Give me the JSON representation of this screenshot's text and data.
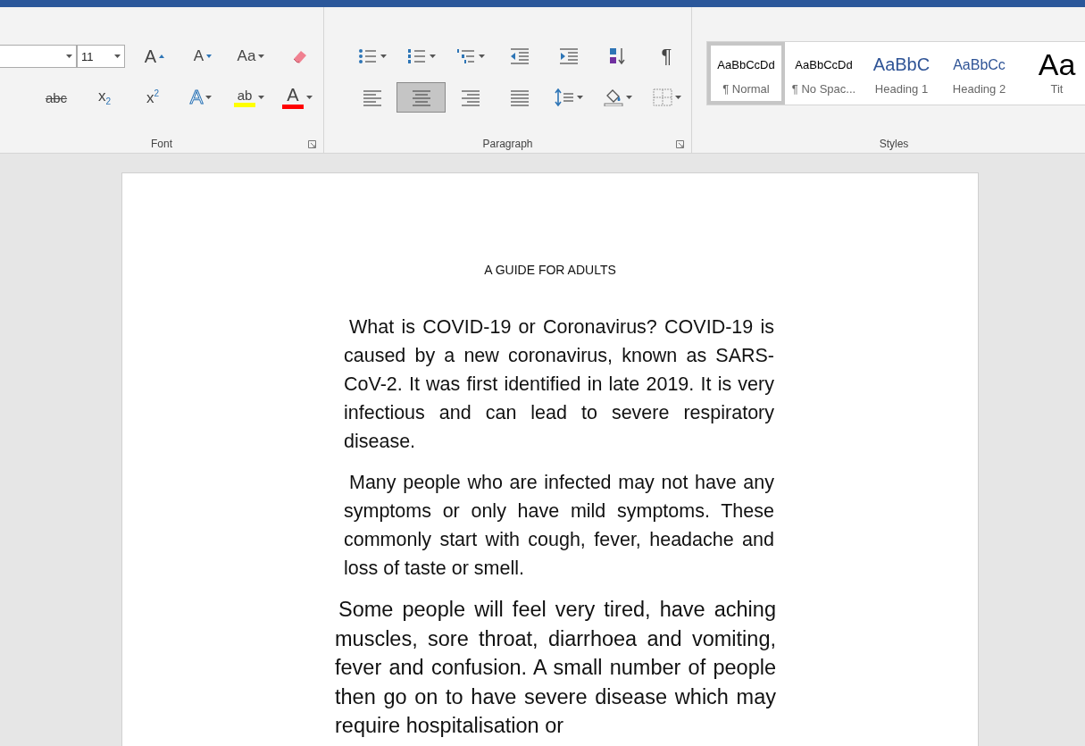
{
  "ribbon": {
    "font": {
      "label": "Font",
      "size": "11",
      "row1": [
        {
          "kind": "grow-font",
          "text": "A",
          "dropdown": false
        },
        {
          "kind": "shrink-font",
          "text": "A",
          "dropdown": false
        },
        {
          "kind": "change-case",
          "text": "Aa",
          "dropdown": true
        },
        {
          "kind": "clear-formatting",
          "dropdown": false
        }
      ],
      "row2": [
        {
          "kind": "strikethrough",
          "text": "abc",
          "dropdown": false
        },
        {
          "kind": "subscript",
          "text": "x$_{2}$",
          "dropdown": false
        },
        {
          "kind": "superscript",
          "text": "x$^{2}$",
          "dropdown": false
        },
        {
          "kind": "text-effects",
          "text": "A",
          "dropdown": true
        },
        {
          "kind": "highlight",
          "text": "ab",
          "dropdown": true
        },
        {
          "kind": "font-color",
          "text": "A",
          "dropdown": true
        }
      ]
    },
    "paragraph": {
      "label": "Paragraph",
      "row1": [
        {
          "kind": "bullets",
          "dropdown": true
        },
        {
          "kind": "numbering",
          "dropdown": true
        },
        {
          "kind": "multilevel",
          "dropdown": true
        },
        {
          "kind": "decrease-indent",
          "dropdown": false
        },
        {
          "kind": "increase-indent",
          "dropdown": false
        },
        {
          "kind": "sort",
          "dropdown": false
        },
        {
          "kind": "show-marks",
          "text": "¶",
          "dropdown": false
        }
      ],
      "alignment": [
        {
          "kind": "align-left",
          "selected": false
        },
        {
          "kind": "align-center",
          "selected": true
        },
        {
          "kind": "align-right",
          "selected": false
        },
        {
          "kind": "justify",
          "selected": false
        }
      ],
      "row2": [
        {
          "kind": "line-spacing",
          "dropdown": true
        },
        {
          "kind": "shading",
          "dropdown": true
        },
        {
          "kind": "borders",
          "dropdown": true
        }
      ]
    },
    "styles": {
      "label": "Styles",
      "items": [
        {
          "kind": "normal",
          "sample": "AaBbCcDd",
          "name": "¶ Normal",
          "selected": true
        },
        {
          "kind": "normal",
          "sample": "AaBbCcDd",
          "name": "¶ No Spac...",
          "selected": false
        },
        {
          "kind": "heading1",
          "sample": "AaBbC",
          "name": "Heading 1",
          "selected": false
        },
        {
          "kind": "heading2",
          "sample": "AaBbCc",
          "name": "Heading 2",
          "selected": false
        },
        {
          "kind": "title",
          "sample": "Aa",
          "name": "Tit",
          "selected": false
        }
      ]
    }
  },
  "document": {
    "heading": "A GUIDE FOR ADULTS",
    "paragraphs": [
      {
        "kind": "body",
        "text": "What is COVID-19 or Coronavirus? COVID-19 is caused by a new coronavirus, known as SARS-CoV-2. It was first identified in late 2019. It is very infectious and can lead to severe respiratory disease."
      },
      {
        "kind": "body",
        "text": "Many people who are infected may not have any symptoms or only have mild symptoms. These commonly start with cough, fever, headache and loss of taste or smell."
      },
      {
        "kind": "large",
        "text": "Some people will feel very tired, have aching muscles, sore throat, diarrhoea and vomiting, fever and confusion. A small number of people then go on to have severe disease which may require hospitalisation or"
      }
    ]
  }
}
